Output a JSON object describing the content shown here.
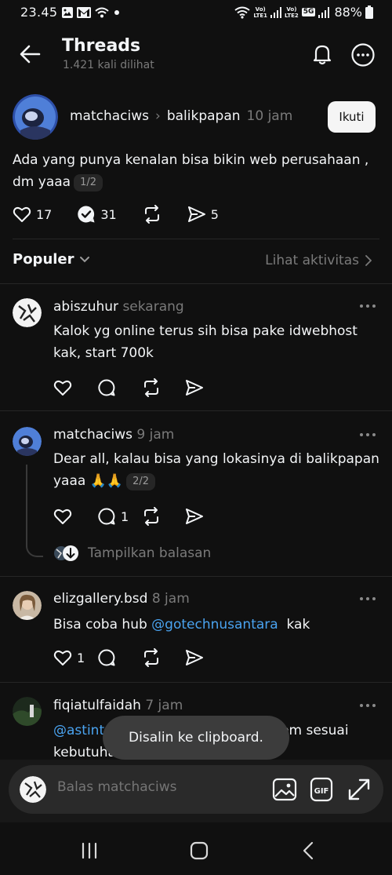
{
  "status_bar": {
    "time": "23.45",
    "sim1_label": "Vo)\nLTE1",
    "sim2_label": "Vo)\nLTE2",
    "network_type": "5G",
    "battery": "88%"
  },
  "header": {
    "title": "Threads",
    "subtitle": "1.421 kali dilihat"
  },
  "post": {
    "username": "matchaciws",
    "location": "balikpapan",
    "time": "10 jam",
    "follow_label": "Ikuti",
    "text": "Ada yang punya kenalan bisa bikin web perusahaan , dm yaaa",
    "part": "1/2",
    "likes": "17",
    "replies": "31",
    "shares": "5"
  },
  "sort": {
    "label": "Populer",
    "activity_link": "Lihat aktivitas"
  },
  "replies": [
    {
      "username": "abiszuhur",
      "time": "sekarang",
      "text": "Kalok yg online terus sih bisa pake idwebhost kak, start 700k",
      "likes": "",
      "comments": ""
    },
    {
      "username": "matchaciws",
      "time": "9 jam",
      "text": "Dear all, kalau bisa yang lokasinya di balikpapan yaaa 🙏🙏",
      "part": "2/2",
      "likes": "",
      "comments": "1",
      "show_replies": "Tampilkan balasan"
    },
    {
      "username": "elizgallery.bsd",
      "time": "8 jam",
      "text_before": "Bisa coba hub ",
      "mention": "@gotechnusantara",
      "text_after": "  kak",
      "likes": "1",
      "comments": ""
    },
    {
      "username": "fiqiatulfaidah",
      "time": "7 jam",
      "mention": "@astintec",
      "text_after": " semua fitur bisa di custom sesuai kebutuhan"
    }
  ],
  "toast": "Disalin ke clipboard.",
  "composer": {
    "placeholder": "Balas matchaciws"
  },
  "colors": {
    "background": "#101010",
    "text": "#f3f5f7",
    "muted": "#7a7a7a",
    "mention": "#4aa3f0",
    "follow_button_bg": "#f5f5f5"
  }
}
